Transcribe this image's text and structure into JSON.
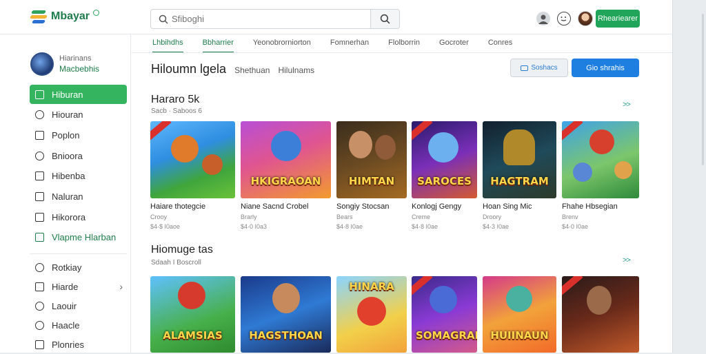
{
  "brand": {
    "name": "Mbayar"
  },
  "search": {
    "placeholder": "Sfiboghi"
  },
  "header": {
    "action_label": "Rheariearer"
  },
  "sidebar": {
    "profile": {
      "name": "Hiarinans",
      "subtitle": "Macbebhis"
    },
    "items": [
      {
        "label": "Hiburan"
      },
      {
        "label": "Hiouran"
      },
      {
        "label": "Poplon"
      },
      {
        "label": "Bnioora"
      },
      {
        "label": "Hibenba"
      },
      {
        "label": "Naluran"
      },
      {
        "label": "Hikorora"
      },
      {
        "label": "Vlapme Hlarban"
      }
    ],
    "items2": [
      {
        "label": "Rotkiay"
      },
      {
        "label": "Hiarde"
      },
      {
        "label": "Laouir"
      },
      {
        "label": "Haacle"
      },
      {
        "label": "Plonries"
      }
    ]
  },
  "tabs": [
    {
      "label": "Lhbihdhs"
    },
    {
      "label": "Bbharrier"
    },
    {
      "label": "Yeonobrorniorton"
    },
    {
      "label": "Fomnerhan"
    },
    {
      "label": "Flolborrin"
    },
    {
      "label": "Gocroter"
    },
    {
      "label": "Conres"
    }
  ],
  "page": {
    "title": "Hiloumn lgela",
    "link1": "Shethuan",
    "link2": "Hilulnams",
    "btn_outline": "Soshacs",
    "btn_primary": "Gio shrahis"
  },
  "sections": [
    {
      "title": "Hararo 5k",
      "subtitle": "Sacb · Saboos 6",
      "more": ">>",
      "cards": [
        {
          "title": "Haiare thotegcie",
          "meta": "Crooy",
          "price": "$4·$ I0aoe",
          "banner": ""
        },
        {
          "title": "Niane Sacnd Crobel",
          "meta": "Brarly",
          "price": "$4·0 I0a3",
          "banner": "HKIGRAOAN"
        },
        {
          "title": "Songiy Stocsan",
          "meta": "Bears",
          "price": "$4·8 I0ae",
          "banner": "HIMTAN"
        },
        {
          "title": "Konlogj Gengy",
          "meta": "Creme",
          "price": "$4·8 I0ae",
          "banner": "SAROCES"
        },
        {
          "title": "Hoan Sing Mic",
          "meta": "Droory",
          "price": "$4·3 I0ae",
          "banner": "HAGTRAM"
        },
        {
          "title": "Fhahe Hbsegian",
          "meta": "Brenv",
          "price": "$4·0 I0ae",
          "banner": ""
        }
      ]
    },
    {
      "title": "Hiomuge tas",
      "subtitle": "Sdaah I Boscroll",
      "more": ">>",
      "cards": [
        {
          "banner": "ALAMSIAS"
        },
        {
          "banner": "HAGSTHOAN"
        },
        {
          "banner": "HINARA"
        },
        {
          "banner": "SOMAGRAM"
        },
        {
          "banner": "HUIINAUN"
        },
        {
          "banner": ""
        }
      ]
    }
  ],
  "colors": {
    "accent": "#34b45e",
    "primary": "#1f7fe0",
    "brand": "#1e7d4a"
  }
}
